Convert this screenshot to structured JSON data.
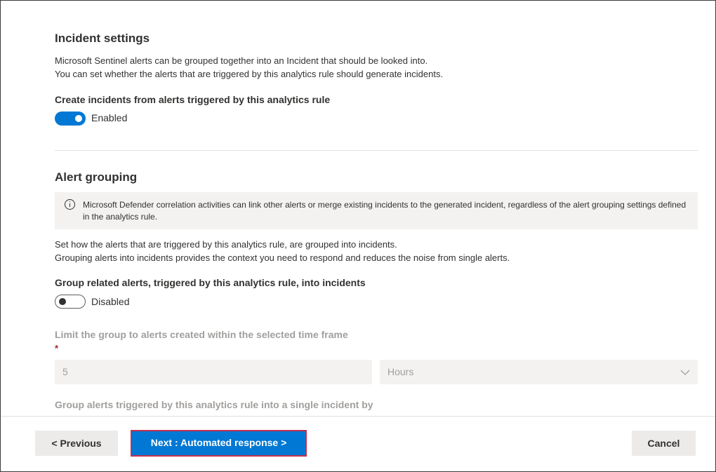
{
  "incident_settings": {
    "title": "Incident settings",
    "desc_line1": "Microsoft Sentinel alerts can be grouped together into an Incident that should be looked into.",
    "desc_line2": "You can set whether the alerts that are triggered by this analytics rule should generate incidents.",
    "create_label": "Create incidents from alerts triggered by this analytics rule",
    "toggle_state": "Enabled"
  },
  "alert_grouping": {
    "title": "Alert grouping",
    "info_text": "Microsoft Defender correlation activities can link other alerts or merge existing incidents to the generated incident, regardless of the alert grouping settings defined in the analytics rule.",
    "desc_line1": "Set how the alerts that are triggered by this analytics rule, are grouped into incidents.",
    "desc_line2": "Grouping alerts into incidents provides the context you need to respond and reduces the noise from single alerts.",
    "group_label": "Group related alerts, triggered by this analytics rule, into incidents",
    "toggle_state": "Disabled",
    "limit_label": "Limit the group to alerts created within the selected time frame",
    "required_mark": "*",
    "time_value": "5",
    "time_unit": "Hours",
    "group_by_label": "Group alerts triggered by this analytics rule into a single incident by"
  },
  "footer": {
    "previous": "< Previous",
    "next": "Next : Automated response >",
    "cancel": "Cancel"
  },
  "colors": {
    "accent": "#0078d4",
    "highlight_border": "#c4314b",
    "required": "#a4262c"
  }
}
